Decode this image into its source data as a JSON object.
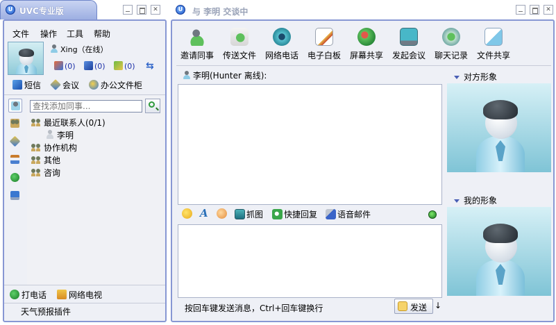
{
  "left_window": {
    "title": "UVC专业版",
    "menu": [
      "文件",
      "操作",
      "工具",
      "帮助"
    ],
    "user": {
      "name": "Xing（在线）"
    },
    "counts": [
      "(0)",
      "(0)",
      "(0)"
    ],
    "quick": {
      "sms": "短信",
      "meeting": "会议",
      "office": "办公文件柜"
    },
    "search": {
      "placeholder": "查找添加同事..."
    },
    "tree": {
      "recent": "最近联系人(0/1)",
      "recent_child": "李明",
      "org": "协作机构",
      "other": "其他",
      "consult": "咨询"
    },
    "bottom": {
      "call": "打电话",
      "tv": "网络电视",
      "plugin": "天气预报插件"
    }
  },
  "right_window": {
    "title": "与 李明 交谈中",
    "toolbar": [
      "邀请同事",
      "传送文件",
      "网络电话",
      "电子白板",
      "屏幕共享",
      "发起会议",
      "聊天记录",
      "文件共享"
    ],
    "peer_status": "李明(Hunter 离线):",
    "chat_tools": {
      "capture": "抓图",
      "quick_reply": "快捷回复",
      "voice_mail": "语音邮件"
    },
    "hint": "按回车键发送消息，Ctrl+回车键换行",
    "send": "发送",
    "peer_avatar_label": "对方形象",
    "my_avatar_label": "我的形象"
  },
  "colors": {
    "frame": "#8797d3",
    "accent": "#1b2fa8",
    "avatar_bg": "#7fc4d6"
  }
}
